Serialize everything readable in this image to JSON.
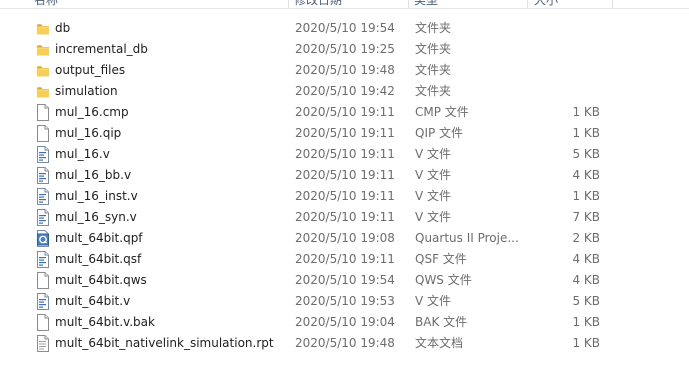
{
  "columns": {
    "name": "名称",
    "date": "修改日期",
    "type": "类型",
    "size": "大小"
  },
  "files": [
    {
      "name": "db",
      "date": "2020/5/10 19:54",
      "type": "文件夹",
      "size": "",
      "icon": "folder-icon"
    },
    {
      "name": "incremental_db",
      "date": "2020/5/10 19:25",
      "type": "文件夹",
      "size": "",
      "icon": "folder-icon"
    },
    {
      "name": "output_files",
      "date": "2020/5/10 19:48",
      "type": "文件夹",
      "size": "",
      "icon": "folder-icon"
    },
    {
      "name": "simulation",
      "date": "2020/5/10 19:42",
      "type": "文件夹",
      "size": "",
      "icon": "folder-icon"
    },
    {
      "name": "mul_16.cmp",
      "date": "2020/5/10 19:11",
      "type": "CMP 文件",
      "size": "1 KB",
      "icon": "blank-file-icon"
    },
    {
      "name": "mul_16.qip",
      "date": "2020/5/10 19:11",
      "type": "QIP 文件",
      "size": "1 KB",
      "icon": "blank-file-icon"
    },
    {
      "name": "mul_16.v",
      "date": "2020/5/10 19:11",
      "type": "V 文件",
      "size": "5 KB",
      "icon": "code-file-icon"
    },
    {
      "name": "mul_16_bb.v",
      "date": "2020/5/10 19:11",
      "type": "V 文件",
      "size": "4 KB",
      "icon": "code-file-icon"
    },
    {
      "name": "mul_16_inst.v",
      "date": "2020/5/10 19:11",
      "type": "V 文件",
      "size": "1 KB",
      "icon": "code-file-icon"
    },
    {
      "name": "mul_16_syn.v",
      "date": "2020/5/10 19:11",
      "type": "V 文件",
      "size": "7 KB",
      "icon": "code-file-icon"
    },
    {
      "name": "mult_64bit.qpf",
      "date": "2020/5/10 19:08",
      "type": "Quartus II Proje...",
      "size": "2 KB",
      "icon": "quartus-project-icon"
    },
    {
      "name": "mult_64bit.qsf",
      "date": "2020/5/10 19:11",
      "type": "QSF 文件",
      "size": "4 KB",
      "icon": "code-file-icon"
    },
    {
      "name": "mult_64bit.qws",
      "date": "2020/5/10 19:54",
      "type": "QWS 文件",
      "size": "4 KB",
      "icon": "blank-file-icon"
    },
    {
      "name": "mult_64bit.v",
      "date": "2020/5/10 19:53",
      "type": "V 文件",
      "size": "5 KB",
      "icon": "code-file-icon"
    },
    {
      "name": "mult_64bit.v.bak",
      "date": "2020/5/10 19:04",
      "type": "BAK 文件",
      "size": "1 KB",
      "icon": "blank-file-icon"
    },
    {
      "name": "mult_64bit_nativelink_simulation.rpt",
      "date": "2020/5/10 19:48",
      "type": "文本文档",
      "size": "1 KB",
      "icon": "text-file-icon"
    }
  ]
}
